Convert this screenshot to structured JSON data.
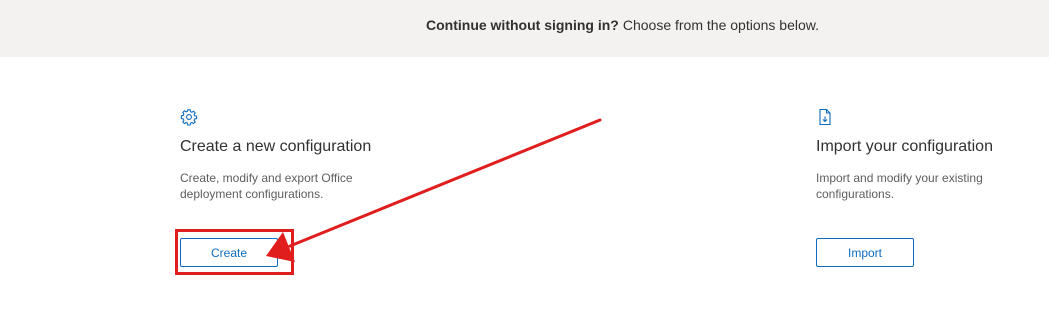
{
  "banner": {
    "bold": "Continue without signing in?",
    "sub": "Choose from the options below."
  },
  "create": {
    "icon": "gear-icon",
    "title": "Create a new configuration",
    "description": "Create, modify and export Office deployment configurations.",
    "button_label": "Create"
  },
  "import": {
    "icon": "document-import-icon",
    "title": "Import your configuration",
    "description": "Import and modify your existing configurations.",
    "button_label": "Import"
  },
  "colors": {
    "accent": "#0f6cbd",
    "annotation": "#e01e1e",
    "banner_bg": "#f3f2f1"
  }
}
